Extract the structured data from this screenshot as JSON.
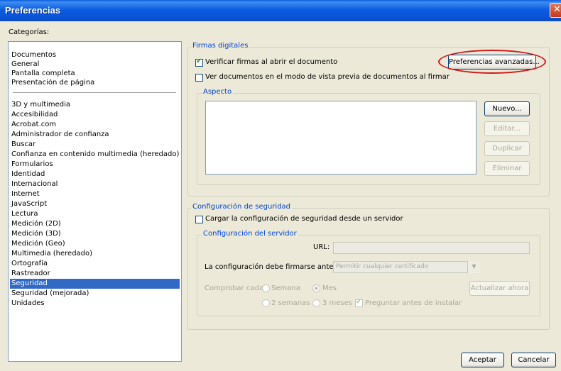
{
  "window": {
    "title": "Preferencias",
    "close_glyph": "✕"
  },
  "categories": {
    "label": "Categorías:",
    "top_items": [
      {
        "label": "Documentos"
      },
      {
        "label": "General"
      },
      {
        "label": "Pantalla completa"
      },
      {
        "label": "Presentación de página"
      }
    ],
    "items": [
      {
        "label": "3D y multimedia"
      },
      {
        "label": "Accesibilidad"
      },
      {
        "label": "Acrobat.com"
      },
      {
        "label": "Administrador de confianza"
      },
      {
        "label": "Buscar"
      },
      {
        "label": "Confianza en contenido multimedia (heredado)"
      },
      {
        "label": "Formularios"
      },
      {
        "label": "Identidad"
      },
      {
        "label": "Internacional"
      },
      {
        "label": "Internet"
      },
      {
        "label": "JavaScript"
      },
      {
        "label": "Lectura"
      },
      {
        "label": "Medición (2D)"
      },
      {
        "label": "Medición (3D)"
      },
      {
        "label": "Medición (Geo)"
      },
      {
        "label": "Multimedia (heredado)"
      },
      {
        "label": "Ortografía"
      },
      {
        "label": "Rastreador"
      },
      {
        "label": "Seguridad",
        "selected": true
      },
      {
        "label": "Seguridad (mejorada)"
      },
      {
        "label": "Unidades"
      }
    ]
  },
  "firmas": {
    "group_title": "Firmas digitales",
    "verify_label": "Verificar firmas al abrir el documento",
    "verify_checked": true,
    "preview_label": "Ver documentos en el modo de vista previa de documentos al firmar",
    "preview_checked": false,
    "advanced_button": "Preferencias avanzadas...",
    "aspect": {
      "group_title": "Aspecto",
      "new_button": "Nuevo...",
      "edit_button": "Editar...",
      "duplicate_button": "Duplicar",
      "delete_button": "Eliminar"
    }
  },
  "security": {
    "group_title": "Configuración de seguridad",
    "load_label": "Cargar la configuración de seguridad desde un servidor",
    "load_checked": false,
    "server": {
      "group_title": "Configuración del servidor",
      "url_label": "URL:",
      "url_value": "",
      "sign_label": "La configuración debe firmarse antes del:",
      "sign_value": "Permitir cualquier certificado",
      "check_label": "Comprobar cada:",
      "radio_week": "Semana",
      "radio_month": "Mes",
      "radio_two_weeks": "2 semanas",
      "radio_three_months": "3 meses",
      "selected_frequency": "Mes",
      "ask_label": "Preguntar antes de instalar",
      "ask_checked": true,
      "update_button": "Actualizar ahora"
    }
  },
  "footer": {
    "ok_button": "Aceptar",
    "cancel_button": "Cancelar"
  },
  "colors": {
    "title_bar": "#0a5fd8",
    "selection": "#316ac5",
    "highlight_oval": "#d11a1a",
    "group_title": "#0046d5"
  }
}
